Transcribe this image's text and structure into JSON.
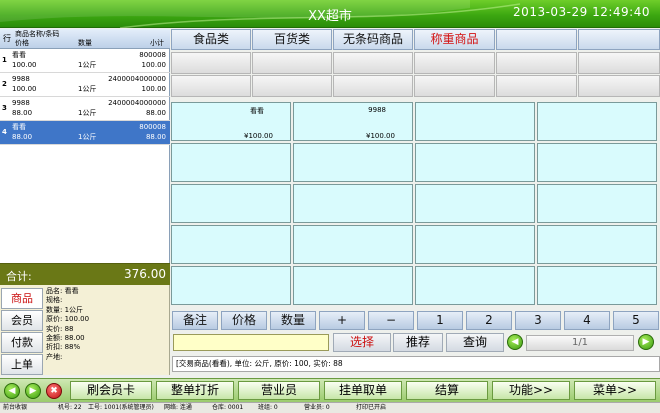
{
  "app": {
    "title": "XX超市",
    "datetime": "2013-03-29 12:49:40"
  },
  "cart": {
    "header": {
      "line_col": "行",
      "name_col": "商品名称/条码",
      "price_col": "价格",
      "qty_col": "数量",
      "subtotal_col": "小计"
    },
    "rows": [
      {
        "idx": "1",
        "name": "看看",
        "code": "800008",
        "price": "100.00",
        "qty": "1公斤",
        "subtotal": "100.00"
      },
      {
        "idx": "2",
        "name": "9988",
        "code": "2400004000000",
        "price": "100.00",
        "qty": "1公斤",
        "subtotal": "100.00"
      },
      {
        "idx": "3",
        "name": "9988",
        "code": "2400004000000",
        "price": "88.00",
        "qty": "1公斤",
        "subtotal": "88.00"
      },
      {
        "idx": "4",
        "name": "看看",
        "code": "800008",
        "price": "88.00",
        "qty": "1公斤",
        "subtotal": "88.00"
      }
    ],
    "selected_index": 3
  },
  "total": {
    "label": "合计:",
    "value": "376.00"
  },
  "side_buttons": [
    "商品",
    "会员",
    "付款",
    "上单"
  ],
  "item_info": {
    "name": "品名: 看看",
    "spec": "规格:",
    "qty": "数量: 1公斤",
    "orig_price": "原价: 100.00",
    "actual_price": "实价: 88",
    "amount": "金额: 88.00",
    "discount": "折扣: 88%",
    "origin": "产地:"
  },
  "categories": [
    "食品类",
    "百货类",
    "无条码商品",
    "称重商品",
    "",
    ""
  ],
  "products": [
    {
      "name": "看看",
      "price": "¥100.00"
    },
    {
      "name": "9988",
      "price": "¥100.00"
    }
  ],
  "function_keys": [
    "备注",
    "价格",
    "数量",
    "+",
    "−",
    "1",
    "2",
    "3",
    "4",
    "5"
  ],
  "search": {
    "value": "",
    "select_label": "选择",
    "recommend_label": "推荐",
    "query_label": "查询"
  },
  "pager": {
    "text": "1/1"
  },
  "message": "[交易商品(看看), 单位: 公斤, 原价: 100, 实价: 88",
  "toolbar": {
    "card": "刷会员卡",
    "whole_discount": "整单打折",
    "clerk": "营业员",
    "hang": "挂单取单",
    "settle": "结算",
    "function": "功能>>",
    "menu": "菜单>>"
  },
  "status": {
    "mode": "前台收银",
    "machine": "机号: 22",
    "worker": "工号: 1001(系统管理员)",
    "network": "网络: 连通",
    "warehouse": "仓库: 0001",
    "group": "班组: 0",
    "clerk": "营业员: 0",
    "printer": "打印已开启"
  },
  "colors": {
    "brand_green": "#3da811",
    "selected_row": "#3f76c8",
    "accent_red": "#d31212",
    "product_tile": "#d9fbfd"
  }
}
